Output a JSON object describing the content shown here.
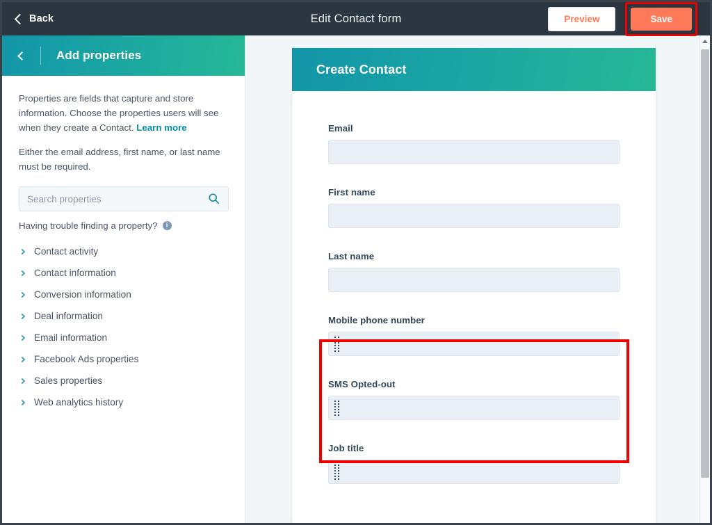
{
  "topbar": {
    "back_label": "Back",
    "title": "Edit Contact form",
    "preview_label": "Preview",
    "save_label": "Save",
    "back_icon": "chevron-left-icon"
  },
  "sidebar": {
    "back_icon": "chevron-left-icon",
    "title": "Add properties",
    "paragraph1_part1": "Properties are fields that capture and store information. Choose the properties users will see when they create a Contact. ",
    "learn_more_label": "Learn more",
    "paragraph2": "Either the email address, first name, or last name must be required.",
    "search": {
      "placeholder": "Search properties",
      "value": "",
      "icon": "search-icon"
    },
    "trouble_text": "Having trouble finding a property?",
    "info_icon": "info-icon",
    "info_icon_glyph": "i",
    "categories": [
      {
        "label": "Contact activity",
        "icon": "chevron-right-icon"
      },
      {
        "label": "Contact information",
        "icon": "chevron-right-icon"
      },
      {
        "label": "Conversion information",
        "icon": "chevron-right-icon"
      },
      {
        "label": "Deal information",
        "icon": "chevron-right-icon"
      },
      {
        "label": "Email information",
        "icon": "chevron-right-icon"
      },
      {
        "label": "Facebook Ads properties",
        "icon": "chevron-right-icon"
      },
      {
        "label": "Sales properties",
        "icon": "chevron-right-icon"
      },
      {
        "label": "Web analytics history",
        "icon": "chevron-right-icon"
      }
    ]
  },
  "form_preview": {
    "header_title": "Create Contact",
    "fields": [
      {
        "label": "Email",
        "value": "",
        "draggable": false
      },
      {
        "label": "First name",
        "value": "",
        "draggable": false
      },
      {
        "label": "Last name",
        "value": "",
        "draggable": false
      },
      {
        "label": "Mobile phone number",
        "value": "",
        "draggable": true
      },
      {
        "label": "SMS Opted-out",
        "value": "",
        "draggable": true
      },
      {
        "label": "Job title",
        "value": "",
        "draggable": true
      }
    ]
  },
  "annotation": {
    "highlight_color": "#ee0000",
    "highlighted_fields": [
      "Mobile phone number",
      "SMS Opted-out"
    ],
    "highlighted_button": "Save"
  },
  "colors": {
    "topbar_bg": "#2b3641",
    "accent_orange": "#ff7a59",
    "teal_start": "#1295a8",
    "teal_end": "#26b896",
    "link_teal": "#0091ae",
    "page_bg": "#f2f6f8",
    "input_bg": "#eaeef5"
  },
  "scrollbar": {
    "up_arrow_icon": "triangle-up-icon",
    "thumb": "scroll-thumb"
  }
}
